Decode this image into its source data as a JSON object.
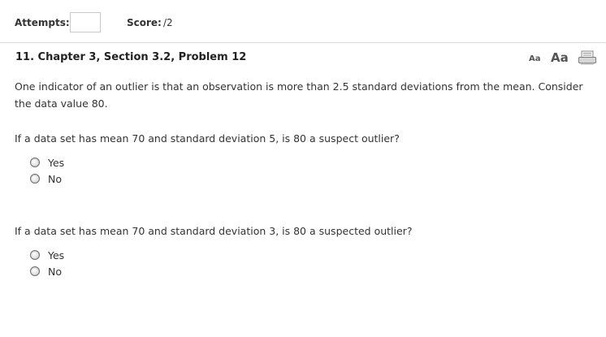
{
  "header": {
    "attempts_label": "Attempts:",
    "attempts_value": "",
    "score_label": "Score:",
    "score_value": "/2"
  },
  "problem": {
    "title": "11. Chapter 3, Section 3.2, Problem 12",
    "font_small_label": "Aa",
    "font_large_label": "Aa",
    "intro": "One indicator of an outlier is that an observation is more than 2.5 standard deviations from the mean. Consider the data value 80.",
    "questions": [
      {
        "text": "If a data set has mean 70 and standard deviation 5, is 80 a suspect outlier?",
        "options": [
          "Yes",
          "No"
        ]
      },
      {
        "text": "If a data set has mean 70 and standard deviation 3, is 80 a suspected outlier?",
        "options": [
          "Yes",
          "No"
        ]
      }
    ]
  },
  "icons": {
    "print": "printer-icon",
    "radio": "radio-button-icon"
  },
  "colors": {
    "text": "#333333",
    "border": "#d9d9d9"
  }
}
